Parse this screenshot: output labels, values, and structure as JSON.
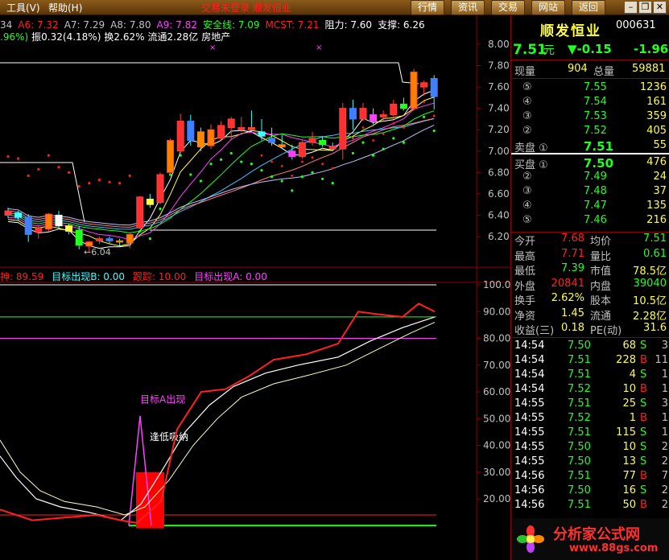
{
  "menu": {
    "tools": "工具(V)",
    "help": "帮助(H)",
    "title": "交易未登录  顺发恒业",
    "buttons": [
      "行情",
      "资讯",
      "交易",
      "网站",
      "返回"
    ]
  },
  "info_line1": [
    {
      "t": "34",
      "c": "#c0c0c0"
    },
    {
      "t": "A6: 7.32",
      "c": "#ff2020"
    },
    {
      "t": "A7: 7.29",
      "c": "#c0c0c0"
    },
    {
      "t": "A8: 7.80",
      "c": "#c0c0c0"
    },
    {
      "t": "A9: 7.82",
      "c": "#ff40ff"
    },
    {
      "t": "安全线: 7.09",
      "c": "#20ff20"
    },
    {
      "t": "MCST: 7.21",
      "c": "#ff2020"
    },
    {
      "t": "阻力: 7.60",
      "c": "#ffffff"
    },
    {
      "t": "支撑: 6.26",
      "c": "#ffffff"
    }
  ],
  "info_line2": [
    {
      "t": ".96%)",
      "c": "#20ff20"
    },
    {
      "t": "振0.32(4.18%)",
      "c": "#ffffff"
    },
    {
      "t": "换2.62%",
      "c": "#ffffff"
    },
    {
      "t": "流通2.28亿",
      "c": "#ffffff"
    },
    {
      "t": "房地产",
      "c": "#ffffff"
    }
  ],
  "indicator_line": [
    {
      "t": "神: 89.59",
      "c": "#ff2020"
    },
    {
      "t": "目标出现B: 0.00",
      "c": "#40ffff"
    },
    {
      "t": "跟踪: 10.00",
      "c": "#ff2020"
    },
    {
      "t": "目标出现A: 0.00",
      "c": "#ff40ff"
    }
  ],
  "price_axis": [
    "8.00",
    "7.80",
    "7.60",
    "7.40",
    "7.20",
    "7.00",
    "6.80",
    "6.60",
    "6.40",
    "6.20"
  ],
  "ind_axis": [
    "100.0",
    "90.00",
    "80.00",
    "70.00",
    "60.00",
    "50.00",
    "40.00",
    "30.00",
    "20.00"
  ],
  "annotations": {
    "low_marker": "←6.04",
    "target_a": "目标A出现",
    "buy_low": "逢低吸纳"
  },
  "stock": {
    "name": "顺发恒业",
    "code": "000631",
    "price": "7.51",
    "unit": "元",
    "change": "▼-0.15",
    "change_pct": "-1.96"
  },
  "volume_row": {
    "label1": "现量",
    "v1": "904",
    "label2": "总量",
    "v2": "59881"
  },
  "sell": [
    {
      "lvl": "⑤",
      "price": "7.55",
      "vol": "1236"
    },
    {
      "lvl": "④",
      "price": "7.54",
      "vol": "161"
    },
    {
      "lvl": "③",
      "price": "7.53",
      "vol": "359"
    },
    {
      "lvl": "②",
      "price": "7.52",
      "vol": "405"
    },
    {
      "lvl": "卖盘 ①",
      "price": "7.51",
      "vol": "55"
    }
  ],
  "buy": [
    {
      "lvl": "买盘 ①",
      "price": "7.50",
      "vol": "476"
    },
    {
      "lvl": "②",
      "price": "7.49",
      "vol": "24"
    },
    {
      "lvl": "③",
      "price": "7.48",
      "vol": "37"
    },
    {
      "lvl": "④",
      "price": "7.47",
      "vol": "135"
    },
    {
      "lvl": "⑤",
      "price": "7.46",
      "vol": "216"
    }
  ],
  "stats": [
    {
      "l1": "今开",
      "v1": "7.68",
      "c1": "#ff2020",
      "l2": "均价",
      "v2": "7.51",
      "c2": "#20ff20"
    },
    {
      "l1": "最高",
      "v1": "7.71",
      "c1": "#ff2020",
      "l2": "量比",
      "v2": "0.61",
      "c2": "#20ff20"
    },
    {
      "l1": "最低",
      "v1": "7.39",
      "c1": "#20ff20",
      "l2": "市值",
      "v2": "78.5亿",
      "c2": "#ffff40"
    },
    {
      "l1": "外盘",
      "v1": "20841",
      "c1": "#ff2020",
      "l2": "内盘",
      "v2": "39040",
      "c2": "#20ff20"
    },
    {
      "l1": "换手",
      "v1": "2.62%",
      "c1": "#ffff40",
      "l2": "股本",
      "v2": "10.5亿",
      "c2": "#ffff40"
    },
    {
      "l1": "净资",
      "v1": "1.45",
      "c1": "#ffff40",
      "l2": "流通",
      "v2": "2.28亿",
      "c2": "#ffff40"
    },
    {
      "l1": "收益(三)",
      "v1": "0.18",
      "c1": "#ffff40",
      "l2": "PE(动)",
      "v2": "31.6",
      "c2": "#ffff40"
    }
  ],
  "ticks": [
    {
      "time": "14:54",
      "price": "7.50",
      "pc": "#20ff20",
      "vol": "68",
      "bs": "S",
      "n": "3"
    },
    {
      "time": "14:54",
      "price": "7.51",
      "pc": "#20ff20",
      "vol": "228",
      "bs": "B",
      "n": "11"
    },
    {
      "time": "14:54",
      "price": "7.51",
      "pc": "#20ff20",
      "vol": "4",
      "bs": "S",
      "n": "1"
    },
    {
      "time": "14:54",
      "price": "7.52",
      "pc": "#20ff20",
      "vol": "10",
      "bs": "B",
      "n": "1"
    },
    {
      "time": "14:55",
      "price": "7.51",
      "pc": "#20ff20",
      "vol": "25",
      "bs": "S",
      "n": "3"
    },
    {
      "time": "14:55",
      "price": "7.52",
      "pc": "#20ff20",
      "vol": "1",
      "bs": "B",
      "n": "1"
    },
    {
      "time": "14:55",
      "price": "7.51",
      "pc": "#20ff20",
      "vol": "115",
      "bs": "S",
      "n": "1"
    },
    {
      "time": "14:55",
      "price": "7.50",
      "pc": "#20ff20",
      "vol": "10",
      "bs": "S",
      "n": "2"
    },
    {
      "time": "14:55",
      "price": "7.50",
      "pc": "#20ff20",
      "vol": "13",
      "bs": "S",
      "n": "2"
    },
    {
      "time": "14:56",
      "price": "7.51",
      "pc": "#20ff20",
      "vol": "77",
      "bs": "B",
      "n": "7"
    },
    {
      "time": "14:56",
      "price": "7.50",
      "pc": "#20ff20",
      "vol": "16",
      "bs": "S",
      "n": "2"
    },
    {
      "time": "14:56",
      "price": "7.51",
      "pc": "#20ff20",
      "vol": "50",
      "bs": "B",
      "n": "2"
    }
  ],
  "watermark": {
    "brand": "分析家公式网",
    "url": "www.88gs.com"
  },
  "colors": {
    "up": "#ff2020",
    "down": "#20ff20",
    "panel_border": "#8b0000"
  },
  "chart_data": {
    "type": "candlestick",
    "ylim": [
      6.0,
      8.1
    ],
    "candles": [
      {
        "o": 6.44,
        "h": 6.47,
        "l": 6.37,
        "c": 6.4
      },
      {
        "o": 6.42,
        "h": 6.44,
        "l": 6.35,
        "c": 6.38
      },
      {
        "o": 6.38,
        "h": 6.41,
        "l": 6.15,
        "c": 6.22
      },
      {
        "o": 6.24,
        "h": 6.3,
        "l": 6.18,
        "c": 6.28
      },
      {
        "o": 6.27,
        "h": 6.42,
        "l": 6.25,
        "c": 6.41
      },
      {
        "o": 6.4,
        "h": 6.44,
        "l": 6.28,
        "c": 6.3
      },
      {
        "o": 6.3,
        "h": 6.32,
        "l": 6.22,
        "c": 6.25
      },
      {
        "o": 6.26,
        "h": 6.3,
        "l": 6.08,
        "c": 6.12
      },
      {
        "o": 6.11,
        "h": 6.16,
        "l": 6.05,
        "c": 6.15
      },
      {
        "o": 6.16,
        "h": 6.2,
        "l": 6.13,
        "c": 6.18
      },
      {
        "o": 6.18,
        "h": 6.2,
        "l": 6.14,
        "c": 6.16
      },
      {
        "o": 6.16,
        "h": 6.18,
        "l": 6.11,
        "c": 6.15
      },
      {
        "o": 6.14,
        "h": 6.24,
        "l": 6.09,
        "c": 6.22
      },
      {
        "o": 6.28,
        "h": 6.58,
        "l": 6.27,
        "c": 6.57
      },
      {
        "o": 6.55,
        "h": 6.6,
        "l": 6.47,
        "c": 6.5
      },
      {
        "o": 6.52,
        "h": 6.8,
        "l": 6.5,
        "c": 6.78
      },
      {
        "o": 6.8,
        "h": 7.12,
        "l": 6.78,
        "c": 7.1
      },
      {
        "o": 7.0,
        "h": 7.35,
        "l": 6.98,
        "c": 7.28
      },
      {
        "o": 7.28,
        "h": 7.34,
        "l": 7.05,
        "c": 7.1
      },
      {
        "o": 7.18,
        "h": 7.22,
        "l": 7.0,
        "c": 7.04
      },
      {
        "o": 7.05,
        "h": 7.25,
        "l": 7.02,
        "c": 7.2
      },
      {
        "o": 7.12,
        "h": 7.28,
        "l": 7.1,
        "c": 7.24
      },
      {
        "o": 7.22,
        "h": 7.32,
        "l": 7.1,
        "c": 7.3
      },
      {
        "o": 7.2,
        "h": 7.32,
        "l": 7.18,
        "c": 7.22
      },
      {
        "o": 7.22,
        "h": 7.38,
        "l": 7.18,
        "c": 7.2
      },
      {
        "o": 7.18,
        "h": 7.3,
        "l": 7.1,
        "c": 7.14
      },
      {
        "o": 7.12,
        "h": 7.22,
        "l": 7.05,
        "c": 7.08
      },
      {
        "o": 7.06,
        "h": 7.15,
        "l": 7.02,
        "c": 7.04
      },
      {
        "o": 7.0,
        "h": 7.06,
        "l": 6.92,
        "c": 6.95
      },
      {
        "o": 6.95,
        "h": 7.1,
        "l": 6.93,
        "c": 7.08
      },
      {
        "o": 7.08,
        "h": 7.18,
        "l": 7.05,
        "c": 7.12
      },
      {
        "o": 7.1,
        "h": 7.14,
        "l": 7.04,
        "c": 7.06
      },
      {
        "o": 7.04,
        "h": 7.08,
        "l": 7.0,
        "c": 7.02
      },
      {
        "o": 7.02,
        "h": 7.45,
        "l": 6.92,
        "c": 7.4
      },
      {
        "o": 7.4,
        "h": 7.48,
        "l": 7.2,
        "c": 7.3
      },
      {
        "o": 7.3,
        "h": 7.45,
        "l": 7.28,
        "c": 7.4
      },
      {
        "o": 7.34,
        "h": 7.4,
        "l": 7.25,
        "c": 7.28
      },
      {
        "o": 7.32,
        "h": 7.38,
        "l": 7.28,
        "c": 7.34
      },
      {
        "o": 7.34,
        "h": 7.48,
        "l": 7.3,
        "c": 7.44
      },
      {
        "o": 7.44,
        "h": 7.5,
        "l": 7.38,
        "c": 7.4
      },
      {
        "o": 7.4,
        "h": 7.77,
        "l": 7.38,
        "c": 7.74
      },
      {
        "o": 7.6,
        "h": 7.66,
        "l": 7.52,
        "c": 7.64
      },
      {
        "o": 7.68,
        "h": 7.71,
        "l": 7.39,
        "c": 7.51
      }
    ]
  }
}
